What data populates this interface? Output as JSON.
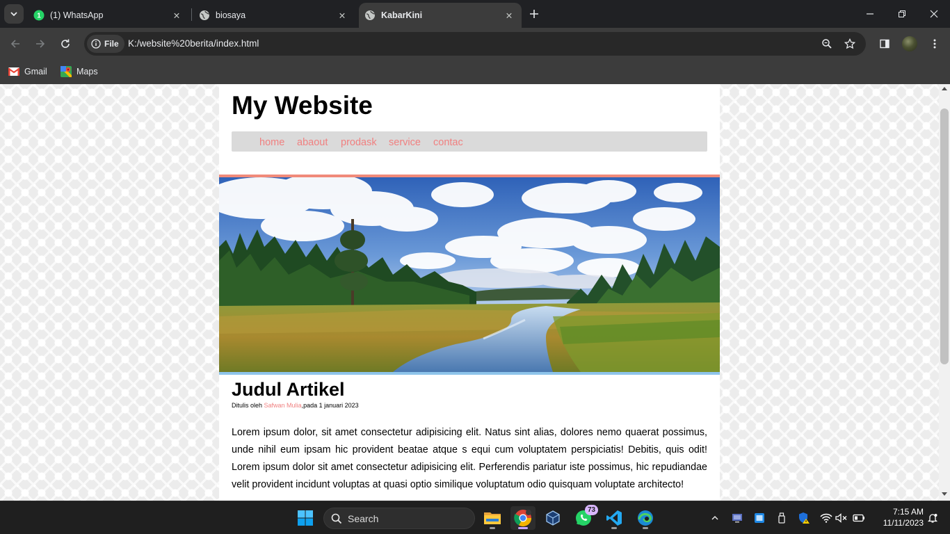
{
  "browser": {
    "tabs": [
      {
        "title": "(1) WhatsApp",
        "favicon": "whatsapp-icon",
        "badge": "1"
      },
      {
        "title": "biosaya",
        "favicon": "globe-icon"
      },
      {
        "title": "KabarKini",
        "favicon": "globe-icon",
        "active": true
      }
    ],
    "address": {
      "chip_label": "File",
      "url": "K:/website%20berita/index.html"
    },
    "bookmarks": [
      {
        "label": "Gmail",
        "icon": "gmail-icon"
      },
      {
        "label": "Maps",
        "icon": "maps-icon"
      }
    ]
  },
  "site": {
    "title": "My Website",
    "nav": [
      "home",
      "abaout",
      "prodask",
      "service",
      "contac"
    ],
    "accent_color": "#f08080",
    "hero_top_border": "#f08a7a",
    "hero_bottom_border": "#8ec4ea"
  },
  "article": {
    "title": "Judul Artikel",
    "byline_prefix": "Ditulis oleh ",
    "author": "Safwan Mulia",
    "byline_suffix": ",pada 1 januari 2023",
    "body": "Lorem ipsum dolor, sit amet consectetur adipisicing elit. Natus sint alias, dolores nemo quaerat possimus, unde nihil eum ipsam hic provident beatae atque s equi cum voluptatem perspiciatis! Debitis, quis odit! Lorem ipsum dolor sit amet consectetur adipisicing elit. Perferendis pariatur iste possimus, hic repudiandae velit provident incidunt voluptas at quasi optio similique voluptatum odio quisquam voluptate architecto!"
  },
  "taskbar": {
    "search_label": "Search",
    "whatsapp_badge": "73",
    "time": "7:15 AM",
    "date": "11/11/2023"
  }
}
